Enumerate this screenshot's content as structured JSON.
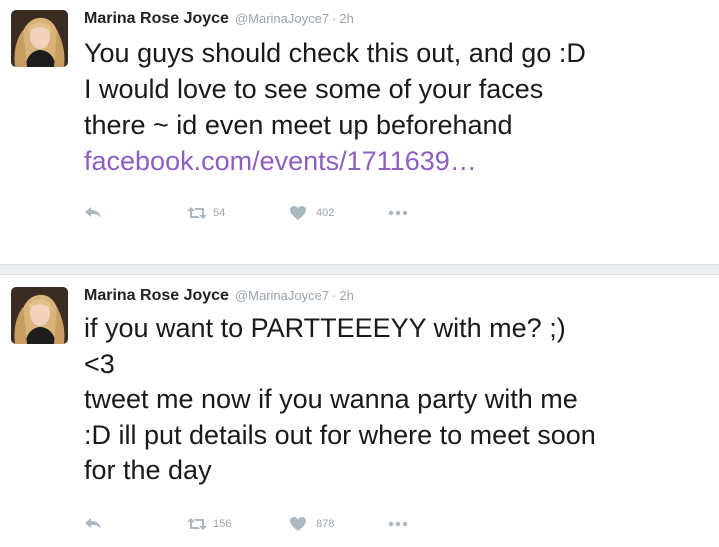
{
  "tweets": [
    {
      "name": "Marina Rose Joyce",
      "handle": "@MarinaJoyce7",
      "separator": "·",
      "time": "2h",
      "lines": [
        "You guys should check this out, and go :D",
        "I would love to see some of your faces",
        "there ~ id even meet up beforehand"
      ],
      "link": "facebook.com/events/1711639…",
      "retweets": "54",
      "likes": "402"
    },
    {
      "name": "Marina Rose Joyce",
      "handle": "@MarinaJoyce7",
      "separator": "·",
      "time": "2h",
      "lines": [
        "if you want to PARTTEEEYY with me? ;)",
        "<3",
        "tweet me now if you wanna party with me",
        ":D ill put details out for where to meet soon",
        "for the day"
      ],
      "retweets": "156",
      "likes": "878"
    }
  ],
  "colors": {
    "link": "#8e5ec2",
    "muted": "#9aa4ad",
    "divider": "#eceff2"
  },
  "icons": [
    "reply-icon",
    "retweet-icon",
    "heart-icon",
    "more-icon"
  ]
}
